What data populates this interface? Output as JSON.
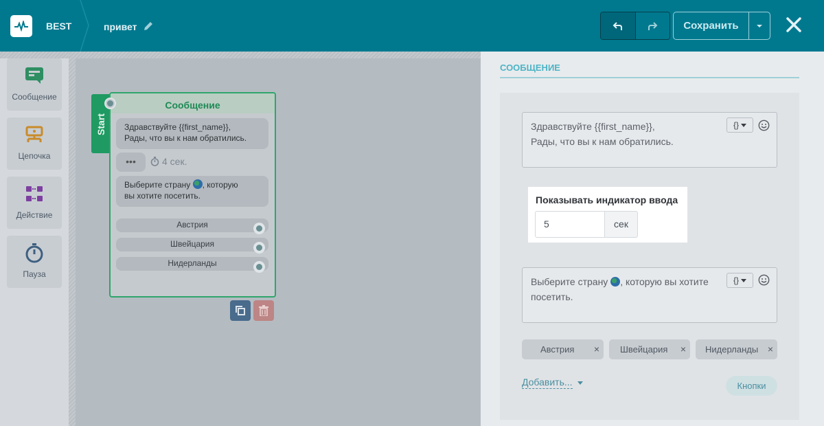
{
  "header": {
    "brand": "BEST",
    "title": "привет",
    "save_label": "Сохранить",
    "accent_color": "#00798f"
  },
  "palette": {
    "items": [
      {
        "label": "Сообщение",
        "icon": "message-icon"
      },
      {
        "label": "Цепочка",
        "icon": "chain-icon"
      },
      {
        "label": "Действие",
        "icon": "action-icon"
      },
      {
        "label": "Пауза",
        "icon": "timer-icon"
      }
    ]
  },
  "node": {
    "start_label": "Start",
    "title": "Сообщение",
    "message_1_line_1": "Здравствуйте  {{first_name}},",
    "message_1_line_2": "Рады, что вы к нам обратились.",
    "typing": "•••",
    "delay": "4 сек.",
    "message_2_line_1a": "Выберите страну ",
    "message_2_line_1b": ", которую",
    "message_2_line_2": "вы хотите посетить.",
    "quick_replies": [
      "Австрия",
      "Швейцария",
      "Нидерланды"
    ]
  },
  "panel": {
    "title": "СООБЩЕНИЕ",
    "text_1_line_1": "Здравствуйте  {{first_name}},",
    "text_1_line_2": "Рады, что вы к нам обратились.",
    "var_button": "{}",
    "typing_indicator_label": "Показывать индикатор ввода",
    "typing_indicator_value": "5",
    "typing_indicator_unit": "сек",
    "text_2_line_1a": "Выберите страну ",
    "text_2_line_1b": ", которую вы хотите",
    "text_2_line_2": "посетить.",
    "tags": [
      "Австрия",
      "Швейцария",
      "Нидерланды"
    ],
    "tag_remove": "×",
    "add_label": "Добавить...",
    "buttons_label": "Кнопки"
  }
}
